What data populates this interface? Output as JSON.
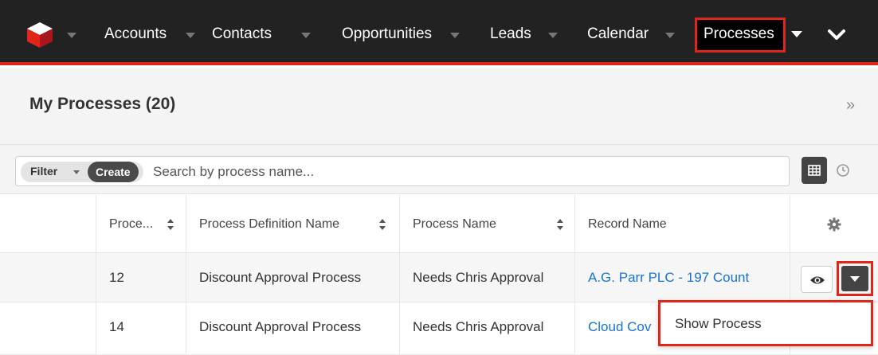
{
  "nav": {
    "items": [
      "Accounts",
      "Contacts",
      "Opportunities",
      "Leads",
      "Calendar"
    ],
    "active": "Processes"
  },
  "header": {
    "title": "My Processes (20)"
  },
  "filterbar": {
    "filter_label": "Filter",
    "create_label": "Create",
    "search_placeholder": "Search by process name..."
  },
  "table": {
    "columns": [
      "Proce...",
      "Process Definition Name",
      "Process Name",
      "Record Name"
    ],
    "rows": [
      {
        "id": "12",
        "definition": "Discount Approval Process",
        "process_name": "Needs Chris Approval",
        "record": "A.G. Parr PLC - 197 Count"
      },
      {
        "id": "14",
        "definition": "Discount Approval Process",
        "process_name": "Needs Chris Approval",
        "record": "Cloud Cov"
      }
    ]
  },
  "row_menu": {
    "items": [
      "Show Process"
    ]
  },
  "colors": {
    "accent": "#e0251b",
    "nav_bg": "#222222",
    "link": "#1773d2"
  }
}
